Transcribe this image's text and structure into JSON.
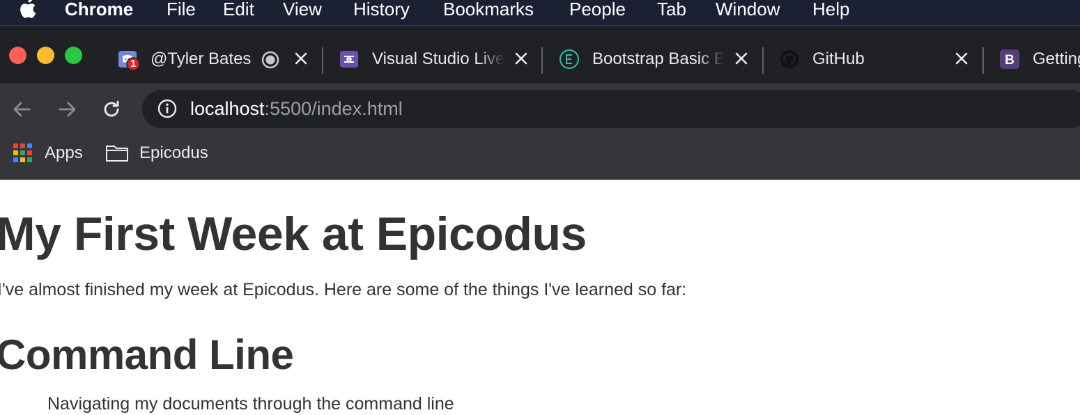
{
  "menubar": {
    "app_name": "Chrome",
    "items": [
      "File",
      "Edit",
      "View",
      "History",
      "Bookmarks",
      "People",
      "Tab",
      "Window",
      "Help"
    ]
  },
  "tabs": [
    {
      "title": "@Tyler Bates",
      "icon": "discord-icon",
      "badge": "1",
      "active": true
    },
    {
      "title": "Visual Studio Live Share",
      "icon": "live-share-icon"
    },
    {
      "title": "Bootstrap Basic Example",
      "icon": "edge-e-icon"
    },
    {
      "title": "GitHub",
      "icon": "github-icon"
    },
    {
      "title": "Getting",
      "icon": "bootstrap-icon"
    }
  ],
  "address_bar": {
    "host": "localhost",
    "rest": ":5500/index.html"
  },
  "bookmarks": [
    {
      "label": "Apps",
      "icon": "apps-grid-icon"
    },
    {
      "label": "Epicodus",
      "icon": "folder-icon"
    }
  ],
  "page": {
    "heading": "My First Week at Epicodus",
    "intro": "I've almost finished my week at Epicodus. Here are some of the things I've learned so far:",
    "section_heading": "Command Line",
    "list_item": "Navigating my documents through the command line"
  },
  "colors": {
    "menubar_bg": "#1b2133",
    "tabstrip_bg": "#202124",
    "toolbar_bg": "#35363a",
    "text_dark": "#333333"
  }
}
